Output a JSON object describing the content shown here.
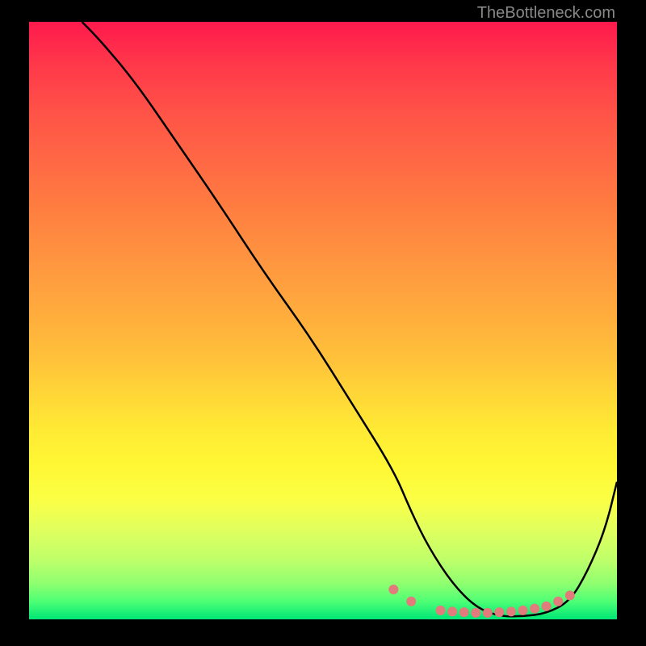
{
  "attribution": "TheBottleneck.com",
  "chart_data": {
    "type": "line",
    "title": "",
    "xlabel": "",
    "ylabel": "",
    "xlim": [
      0,
      100
    ],
    "ylim": [
      0,
      100
    ],
    "series": [
      {
        "name": "bottleneck-curve",
        "x": [
          9,
          12,
          18,
          25,
          32,
          40,
          48,
          55,
          62,
          65,
          68,
          72,
          76,
          80,
          84,
          88,
          92,
          95,
          98,
          100
        ],
        "y": [
          100,
          97,
          90,
          80,
          70,
          58,
          47,
          36,
          25,
          18,
          12,
          6,
          2,
          0.5,
          0.5,
          1,
          3,
          8,
          15,
          23
        ]
      }
    ],
    "markers": {
      "name": "highlight-dots",
      "color": "#e27b7b",
      "points": [
        {
          "x": 62,
          "y": 5
        },
        {
          "x": 65,
          "y": 3
        },
        {
          "x": 70,
          "y": 1.5
        },
        {
          "x": 72,
          "y": 1.3
        },
        {
          "x": 74,
          "y": 1.2
        },
        {
          "x": 76,
          "y": 1.1
        },
        {
          "x": 78,
          "y": 1.1
        },
        {
          "x": 80,
          "y": 1.2
        },
        {
          "x": 82,
          "y": 1.3
        },
        {
          "x": 84,
          "y": 1.5
        },
        {
          "x": 86,
          "y": 1.8
        },
        {
          "x": 88,
          "y": 2.2
        },
        {
          "x": 90,
          "y": 3
        },
        {
          "x": 92,
          "y": 4
        }
      ]
    },
    "gradient_stops": [
      {
        "pos": 0,
        "color": "#ff1a4d"
      },
      {
        "pos": 50,
        "color": "#ffc03a"
      },
      {
        "pos": 80,
        "color": "#fbff45"
      },
      {
        "pos": 100,
        "color": "#00e676"
      }
    ]
  }
}
